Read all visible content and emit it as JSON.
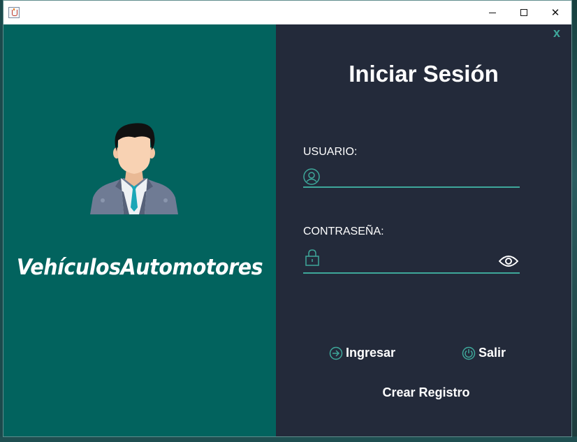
{
  "window": {
    "title": "",
    "controls": {
      "minimize": "minimize",
      "maximize": "maximize",
      "close": "✕"
    }
  },
  "left_panel": {
    "brand": "VehículosAutomotores",
    "avatar_icon": "businessman-avatar-icon",
    "background": "#02635e"
  },
  "right_panel": {
    "close_label": "x",
    "title": "Iniciar Sesión",
    "username": {
      "label": "USUARIO:",
      "value": "",
      "placeholder": ""
    },
    "password": {
      "label": "CONTRASEÑA:",
      "value": "",
      "placeholder": ""
    },
    "actions": {
      "login": "Ingresar",
      "exit": "Salir",
      "register": "Crear Registro"
    },
    "background": "#232a3a",
    "accent": "#3ea79a"
  }
}
